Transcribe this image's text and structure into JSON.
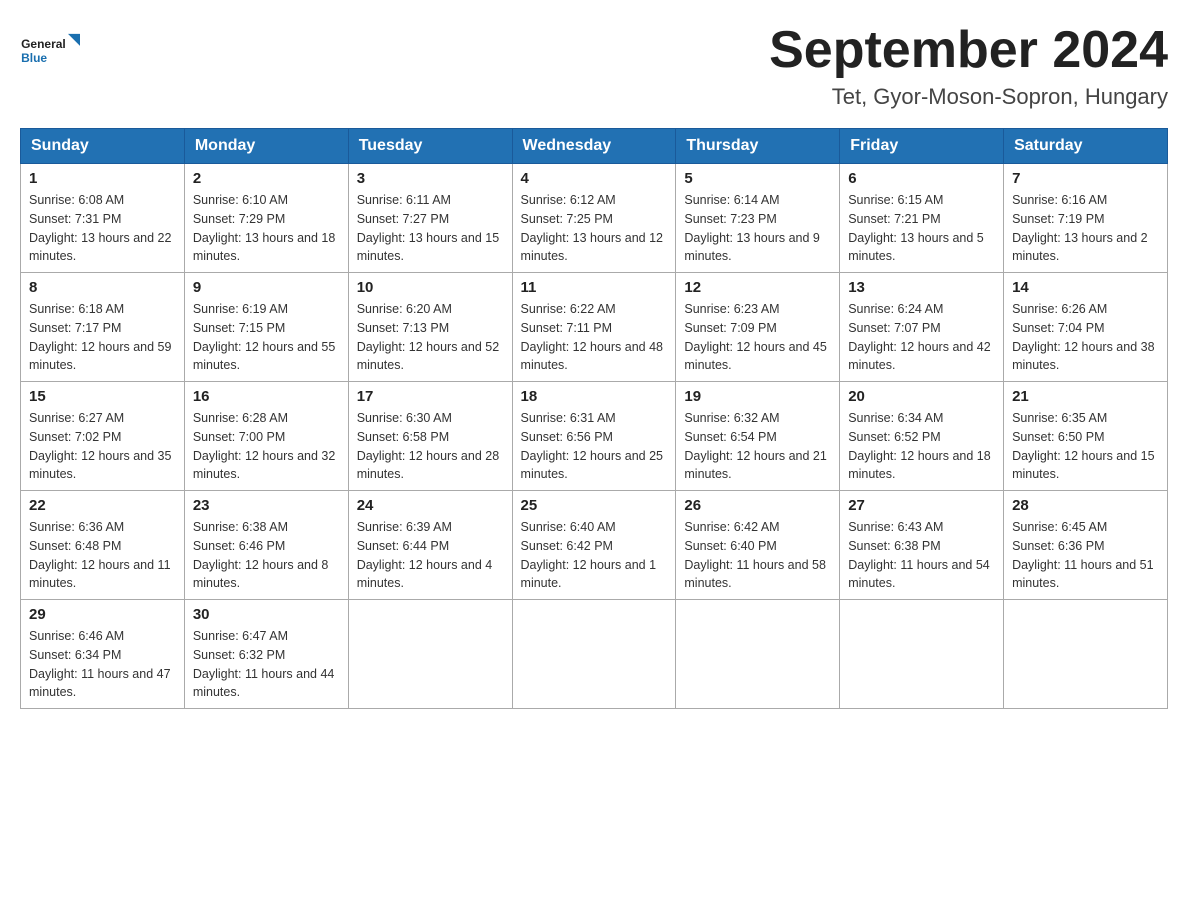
{
  "header": {
    "title": "September 2024",
    "location": "Tet, Gyor-Moson-Sopron, Hungary",
    "logo_general": "General",
    "logo_blue": "Blue"
  },
  "weekdays": [
    "Sunday",
    "Monday",
    "Tuesday",
    "Wednesday",
    "Thursday",
    "Friday",
    "Saturday"
  ],
  "weeks": [
    [
      {
        "day": "1",
        "sunrise": "6:08 AM",
        "sunset": "7:31 PM",
        "daylight": "13 hours and 22 minutes."
      },
      {
        "day": "2",
        "sunrise": "6:10 AM",
        "sunset": "7:29 PM",
        "daylight": "13 hours and 18 minutes."
      },
      {
        "day": "3",
        "sunrise": "6:11 AM",
        "sunset": "7:27 PM",
        "daylight": "13 hours and 15 minutes."
      },
      {
        "day": "4",
        "sunrise": "6:12 AM",
        "sunset": "7:25 PM",
        "daylight": "13 hours and 12 minutes."
      },
      {
        "day": "5",
        "sunrise": "6:14 AM",
        "sunset": "7:23 PM",
        "daylight": "13 hours and 9 minutes."
      },
      {
        "day": "6",
        "sunrise": "6:15 AM",
        "sunset": "7:21 PM",
        "daylight": "13 hours and 5 minutes."
      },
      {
        "day": "7",
        "sunrise": "6:16 AM",
        "sunset": "7:19 PM",
        "daylight": "13 hours and 2 minutes."
      }
    ],
    [
      {
        "day": "8",
        "sunrise": "6:18 AM",
        "sunset": "7:17 PM",
        "daylight": "12 hours and 59 minutes."
      },
      {
        "day": "9",
        "sunrise": "6:19 AM",
        "sunset": "7:15 PM",
        "daylight": "12 hours and 55 minutes."
      },
      {
        "day": "10",
        "sunrise": "6:20 AM",
        "sunset": "7:13 PM",
        "daylight": "12 hours and 52 minutes."
      },
      {
        "day": "11",
        "sunrise": "6:22 AM",
        "sunset": "7:11 PM",
        "daylight": "12 hours and 48 minutes."
      },
      {
        "day": "12",
        "sunrise": "6:23 AM",
        "sunset": "7:09 PM",
        "daylight": "12 hours and 45 minutes."
      },
      {
        "day": "13",
        "sunrise": "6:24 AM",
        "sunset": "7:07 PM",
        "daylight": "12 hours and 42 minutes."
      },
      {
        "day": "14",
        "sunrise": "6:26 AM",
        "sunset": "7:04 PM",
        "daylight": "12 hours and 38 minutes."
      }
    ],
    [
      {
        "day": "15",
        "sunrise": "6:27 AM",
        "sunset": "7:02 PM",
        "daylight": "12 hours and 35 minutes."
      },
      {
        "day": "16",
        "sunrise": "6:28 AM",
        "sunset": "7:00 PM",
        "daylight": "12 hours and 32 minutes."
      },
      {
        "day": "17",
        "sunrise": "6:30 AM",
        "sunset": "6:58 PM",
        "daylight": "12 hours and 28 minutes."
      },
      {
        "day": "18",
        "sunrise": "6:31 AM",
        "sunset": "6:56 PM",
        "daylight": "12 hours and 25 minutes."
      },
      {
        "day": "19",
        "sunrise": "6:32 AM",
        "sunset": "6:54 PM",
        "daylight": "12 hours and 21 minutes."
      },
      {
        "day": "20",
        "sunrise": "6:34 AM",
        "sunset": "6:52 PM",
        "daylight": "12 hours and 18 minutes."
      },
      {
        "day": "21",
        "sunrise": "6:35 AM",
        "sunset": "6:50 PM",
        "daylight": "12 hours and 15 minutes."
      }
    ],
    [
      {
        "day": "22",
        "sunrise": "6:36 AM",
        "sunset": "6:48 PM",
        "daylight": "12 hours and 11 minutes."
      },
      {
        "day": "23",
        "sunrise": "6:38 AM",
        "sunset": "6:46 PM",
        "daylight": "12 hours and 8 minutes."
      },
      {
        "day": "24",
        "sunrise": "6:39 AM",
        "sunset": "6:44 PM",
        "daylight": "12 hours and 4 minutes."
      },
      {
        "day": "25",
        "sunrise": "6:40 AM",
        "sunset": "6:42 PM",
        "daylight": "12 hours and 1 minute."
      },
      {
        "day": "26",
        "sunrise": "6:42 AM",
        "sunset": "6:40 PM",
        "daylight": "11 hours and 58 minutes."
      },
      {
        "day": "27",
        "sunrise": "6:43 AM",
        "sunset": "6:38 PM",
        "daylight": "11 hours and 54 minutes."
      },
      {
        "day": "28",
        "sunrise": "6:45 AM",
        "sunset": "6:36 PM",
        "daylight": "11 hours and 51 minutes."
      }
    ],
    [
      {
        "day": "29",
        "sunrise": "6:46 AM",
        "sunset": "6:34 PM",
        "daylight": "11 hours and 47 minutes."
      },
      {
        "day": "30",
        "sunrise": "6:47 AM",
        "sunset": "6:32 PM",
        "daylight": "11 hours and 44 minutes."
      },
      null,
      null,
      null,
      null,
      null
    ]
  ],
  "labels": {
    "sunrise": "Sunrise:",
    "sunset": "Sunset:",
    "daylight": "Daylight:"
  }
}
